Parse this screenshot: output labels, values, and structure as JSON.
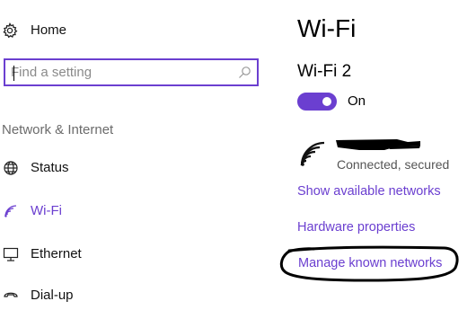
{
  "sidebar": {
    "home_label": "Home",
    "search": {
      "placeholder": "Find a setting"
    },
    "section_label": "Network & Internet",
    "items": [
      {
        "label": "Status",
        "icon": "globe-icon"
      },
      {
        "label": "Wi-Fi",
        "icon": "wifi-icon",
        "active": true
      },
      {
        "label": "Ethernet",
        "icon": "ethernet-icon"
      },
      {
        "label": "Dial-up",
        "icon": "dial-up-icon"
      }
    ]
  },
  "main": {
    "title": "Wi-Fi",
    "network_name": "Wi-Fi 2",
    "toggle": {
      "state_label": "On",
      "on": true
    },
    "connection": {
      "status": "Connected, secured",
      "icon": "wifi-signal-icon"
    },
    "links": {
      "show_networks": "Show available networks",
      "hardware_properties": "Hardware properties",
      "manage_networks": "Manage known networks"
    }
  },
  "colors": {
    "accent": "#6b3fd0",
    "text": "#000000",
    "muted": "#6b6b6b"
  }
}
